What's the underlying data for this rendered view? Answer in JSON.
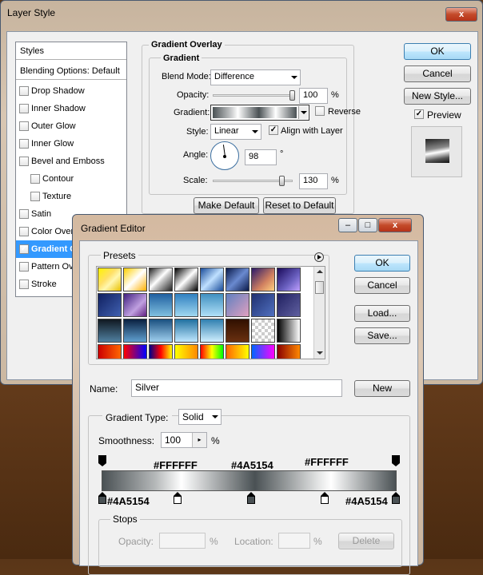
{
  "layer_style": {
    "title": "Layer Style",
    "styles_header": "Styles",
    "blending_options": "Blending Options: Default",
    "items": [
      {
        "label": "Drop Shadow",
        "checked": false,
        "indent": false
      },
      {
        "label": "Inner Shadow",
        "checked": false,
        "indent": false
      },
      {
        "label": "Outer Glow",
        "checked": false,
        "indent": false
      },
      {
        "label": "Inner Glow",
        "checked": false,
        "indent": false
      },
      {
        "label": "Bevel and Emboss",
        "checked": false,
        "indent": false
      },
      {
        "label": "Contour",
        "checked": false,
        "indent": true
      },
      {
        "label": "Texture",
        "checked": false,
        "indent": true
      },
      {
        "label": "Satin",
        "checked": false,
        "indent": false
      },
      {
        "label": "Color Overlay",
        "checked": false,
        "indent": false
      },
      {
        "label": "Gradient Overlay",
        "checked": true,
        "indent": false
      },
      {
        "label": "Pattern Overlay",
        "checked": false,
        "indent": false
      },
      {
        "label": "Stroke",
        "checked": false,
        "indent": false
      }
    ],
    "section_title": "Gradient Overlay",
    "group_title": "Gradient",
    "blend_mode_label": "Blend Mode:",
    "blend_mode_value": "Difference",
    "opacity_label": "Opacity:",
    "opacity_value": "100",
    "opacity_unit": "%",
    "opacity_fraction": 1.0,
    "gradient_label": "Gradient:",
    "reverse_label": "Reverse",
    "style_label": "Style:",
    "style_value": "Linear",
    "align_label": "Align with Layer",
    "angle_label": "Angle:",
    "angle_value": "98",
    "angle_unit": "°",
    "scale_label": "Scale:",
    "scale_value": "130",
    "scale_unit": "%",
    "scale_fraction": 0.87,
    "make_default": "Make Default",
    "reset_default": "Reset to Default",
    "ok": "OK",
    "cancel": "Cancel",
    "new_style": "New Style...",
    "preview_label": "Preview",
    "close_glyph": "x"
  },
  "gradient_editor": {
    "title": "Gradient Editor",
    "presets_label": "Presets",
    "ok": "OK",
    "cancel": "Cancel",
    "load": "Load...",
    "save": "Save...",
    "name_label": "Name:",
    "name_value": "Silver",
    "new_button": "New",
    "gradient_type_label": "Gradient Type:",
    "gradient_type_value": "Solid",
    "smoothness_label": "Smoothness:",
    "smoothness_value": "100",
    "smoothness_unit": "%",
    "hex_top_left": "#FFFFFF",
    "hex_top_mid": "#4A5154",
    "hex_top_right": "#FFFFFF",
    "hex_bottom_left": "#4A5154",
    "hex_bottom_right": "#4A5154",
    "stops_label": "Stops",
    "stop_opacity_label": "Opacity:",
    "stop_opacity_unit": "%",
    "stop_location_label": "Location:",
    "stop_location_unit": "%",
    "delete_button": "Delete",
    "min_glyph": "–",
    "max_glyph": "□",
    "close_glyph": "x",
    "colors": {
      "dark": "#4A5154",
      "light": "#FFFFFF"
    }
  }
}
